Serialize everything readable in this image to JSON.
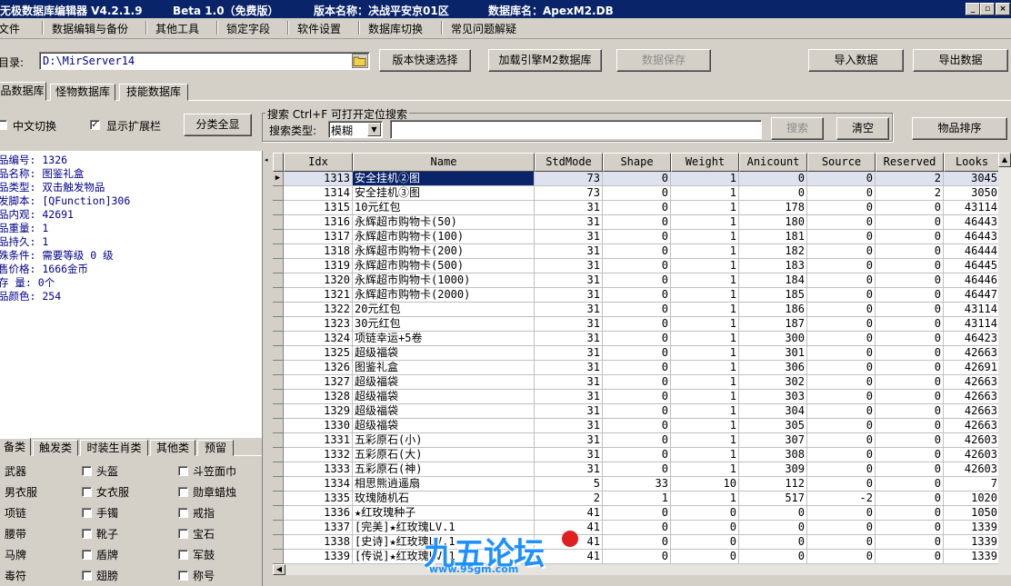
{
  "title": {
    "app": "无极数据库编辑器 V4.2.1.9",
    "edition": "Beta 1.0（免费版）",
    "version_label": "版本名称：决战平安京01区",
    "db_label": "数据库名：ApexM2.DB",
    "min_glyph": "_",
    "max_glyph": "▫",
    "close_glyph": "×"
  },
  "menu": [
    "文件",
    "数据编辑与备份",
    "其他工具",
    "锁定字段",
    "软件设置",
    "数据库切换",
    "常见问题解疑"
  ],
  "toolbar": {
    "dir_label": "目录:",
    "dir_value": "D:\\MirServer14",
    "btn_version_select": "版本快速选择",
    "btn_load_engine": "加载引擎M2数据库",
    "btn_save": "数据保存",
    "btn_import": "导入数据",
    "btn_export": "导出数据"
  },
  "db_tabs": [
    "品数据库",
    "怪物数据库",
    "技能数据库"
  ],
  "options": {
    "chinese_toggle": "中文切换",
    "show_ext": "显示扩展栏",
    "show_all": "分类全显",
    "check_mark": "✓"
  },
  "search": {
    "group_title": "搜索  Ctrl+F 可打开定位搜索",
    "type_label": "搜索类型:",
    "type_value": "模糊",
    "value": "",
    "btn_search": "搜索",
    "btn_clear": "清空",
    "btn_sort": "物品排序"
  },
  "item_info": [
    "品编号: 1326",
    "品名称: 图鉴礼盒",
    "品类型: 双击触发物品",
    "发脚本: [QFunction]306",
    "品内观: 42691",
    "品重量: 1",
    "品持久: 1",
    "殊条件: 需要等级 0 级",
    "售价格: 1666金币",
    "存 量: 0个",
    "品颜色: 254"
  ],
  "cat_tabs": [
    "备类",
    "触发类",
    "时装生肖类",
    "其他类",
    "预留"
  ],
  "categories": [
    [
      "武器",
      "头盔",
      "斗笠面巾"
    ],
    [
      "男衣服",
      "女衣服",
      "勋章蜡烛"
    ],
    [
      "项链",
      "手镯",
      "戒指"
    ],
    [
      "腰带",
      "靴子",
      "宝石"
    ],
    [
      "马牌",
      "盾牌",
      "军鼓"
    ],
    [
      "毒符",
      "翅膀",
      "称号"
    ]
  ],
  "grid": {
    "columns": [
      "Idx",
      "Name",
      "StdMode",
      "Shape",
      "Weight",
      "Anicount",
      "Source",
      "Reserved",
      "Looks"
    ],
    "row_pointer": "▶",
    "rows": [
      [
        1313,
        "安全挂机②图",
        73,
        0,
        1,
        0,
        0,
        2,
        3045
      ],
      [
        1314,
        "安全挂机③图",
        73,
        0,
        1,
        0,
        0,
        2,
        3050
      ],
      [
        1315,
        "10元红包",
        31,
        0,
        1,
        178,
        0,
        0,
        43114
      ],
      [
        1316,
        "永辉超市购物卡(50)",
        31,
        0,
        1,
        180,
        0,
        0,
        46443
      ],
      [
        1317,
        "永辉超市购物卡(100)",
        31,
        0,
        1,
        181,
        0,
        0,
        46443
      ],
      [
        1318,
        "永辉超市购物卡(200)",
        31,
        0,
        1,
        182,
        0,
        0,
        46444
      ],
      [
        1319,
        "永辉超市购物卡(500)",
        31,
        0,
        1,
        183,
        0,
        0,
        46445
      ],
      [
        1320,
        "永辉超市购物卡(1000)",
        31,
        0,
        1,
        184,
        0,
        0,
        46446
      ],
      [
        1321,
        "永辉超市购物卡(2000)",
        31,
        0,
        1,
        185,
        0,
        0,
        46447
      ],
      [
        1322,
        "20元红包",
        31,
        0,
        1,
        186,
        0,
        0,
        43114
      ],
      [
        1323,
        "30元红包",
        31,
        0,
        1,
        187,
        0,
        0,
        43114
      ],
      [
        1324,
        "项链幸运+5卷",
        31,
        0,
        1,
        300,
        0,
        0,
        46423
      ],
      [
        1325,
        "超级福袋",
        31,
        0,
        1,
        301,
        0,
        0,
        42663
      ],
      [
        1326,
        "图鉴礼盒",
        31,
        0,
        1,
        306,
        0,
        0,
        42691
      ],
      [
        1327,
        "超级福袋",
        31,
        0,
        1,
        302,
        0,
        0,
        42663
      ],
      [
        1328,
        "超级福袋",
        31,
        0,
        1,
        303,
        0,
        0,
        42663
      ],
      [
        1329,
        "超级福袋",
        31,
        0,
        1,
        304,
        0,
        0,
        42663
      ],
      [
        1330,
        "超级福袋",
        31,
        0,
        1,
        305,
        0,
        0,
        42663
      ],
      [
        1331,
        "五彩原石(小)",
        31,
        0,
        1,
        307,
        0,
        0,
        42603
      ],
      [
        1332,
        "五彩原石(大)",
        31,
        0,
        1,
        308,
        0,
        0,
        42603
      ],
      [
        1333,
        "五彩原石(神)",
        31,
        0,
        1,
        309,
        0,
        0,
        42603
      ],
      [
        1334,
        "相思熊逍遥扇",
        5,
        33,
        10,
        112,
        0,
        0,
        7
      ],
      [
        1335,
        "玫瑰随机石",
        2,
        1,
        1,
        517,
        -2,
        0,
        1020
      ],
      [
        1336,
        "★红玫瑰种子",
        41,
        0,
        0,
        0,
        0,
        0,
        1050
      ],
      [
        1337,
        "[完美]★红玫瑰LV.1",
        41,
        0,
        0,
        0,
        0,
        0,
        1339
      ],
      [
        1338,
        "[史诗]★红玫瑰LV.1",
        41,
        0,
        0,
        0,
        0,
        0,
        1339
      ],
      [
        1339,
        "[传说]★红玫瑰LV.1",
        41,
        0,
        0,
        0,
        0,
        0,
        1339
      ]
    ]
  },
  "watermark": {
    "logo_text": "九五论坛",
    "url": "www.95gm.com"
  },
  "colors": {
    "title_bg": "#0a246a",
    "selection": "#0a246a",
    "info_text": "#00008b"
  }
}
